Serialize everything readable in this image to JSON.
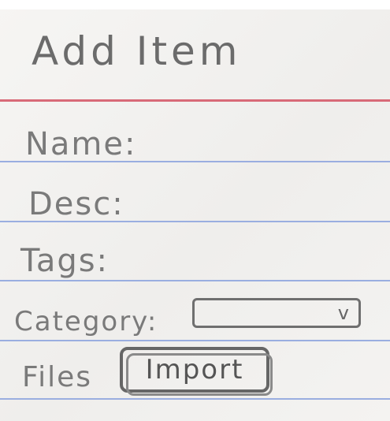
{
  "form": {
    "title": "Add Item",
    "name_label": "Name:",
    "desc_label": "Desc:",
    "tags_label": "Tags:",
    "category_label": "Category:",
    "category_select": {
      "value": "",
      "chevron": "v"
    },
    "files_label": "Files",
    "import_button": "Import"
  },
  "colors": {
    "header_rule": "#d86a78",
    "ruled_line": "#9aaee0"
  }
}
